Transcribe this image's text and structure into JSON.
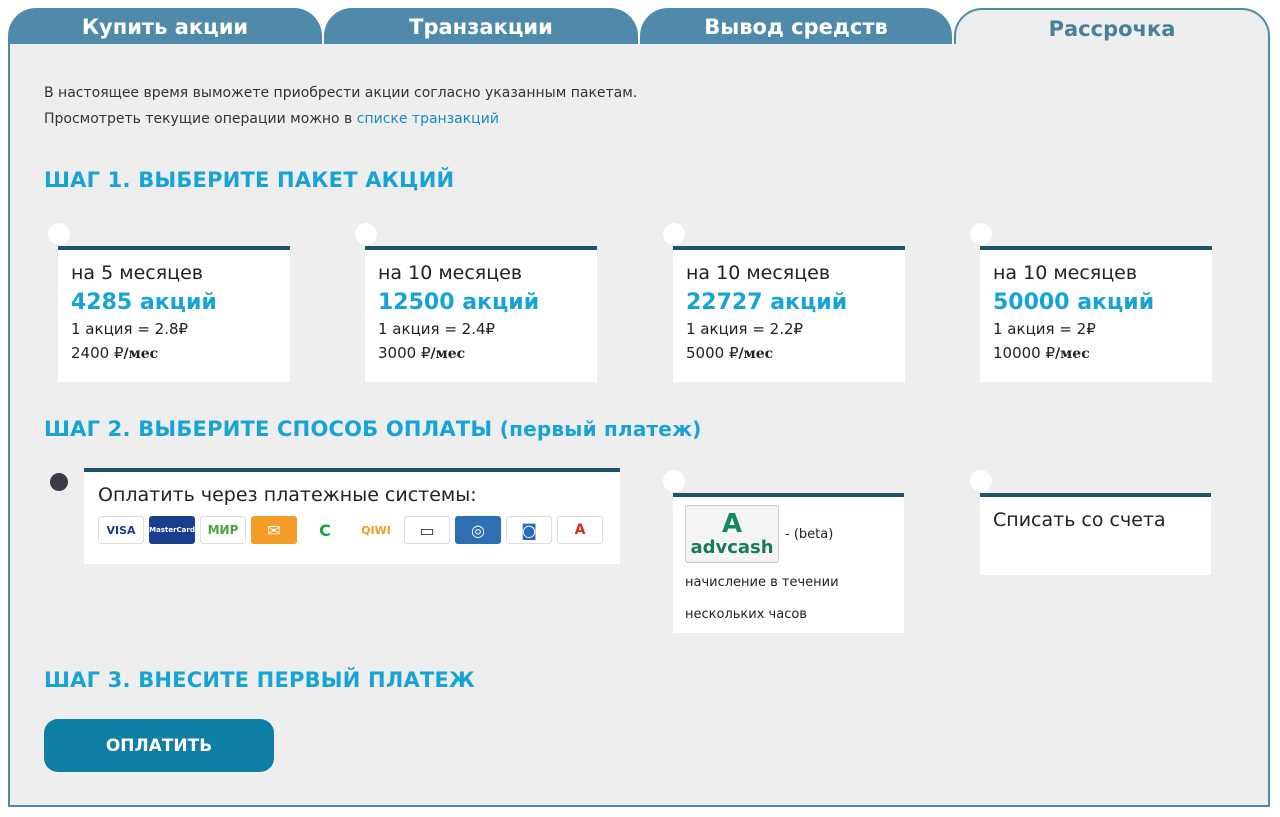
{
  "tabs": [
    {
      "label": "Купить акции",
      "active": false
    },
    {
      "label": "Транзакции",
      "active": false
    },
    {
      "label": "Вывод средств",
      "active": false
    },
    {
      "label": "Рассрочка",
      "active": true
    }
  ],
  "intro": {
    "line1": "В настоящее время выможете приобрести акции согласно указанным пакетам.",
    "line2_prefix": "Просмотреть текущие операции можно в ",
    "line2_link": "списке транзакций"
  },
  "step1": {
    "title": "ШАГ 1. ВЫБЕРИТЕ ПАКЕТ АКЦИЙ"
  },
  "packages": [
    {
      "months": "на 5 месяцев",
      "shares": "4285 акций",
      "price": "1 акция = 2.8₽",
      "monthly": "2400 ₽",
      "unit": "/мес"
    },
    {
      "months": "на 10 месяцев",
      "shares": "12500 акций",
      "price": "1 акция = 2.4₽",
      "monthly": "3000 ₽",
      "unit": "/мес"
    },
    {
      "months": "на 10 месяцев",
      "shares": "22727 акций",
      "price": "1 акция = 2.2₽",
      "monthly": "5000 ₽",
      "unit": "/мес"
    },
    {
      "months": "на 10 месяцев",
      "shares": "50000 акций",
      "price": "1 акция = 2₽",
      "monthly": "10000 ₽",
      "unit": "/мес"
    }
  ],
  "step2": {
    "title": "ШАГ 2. ВЫБЕРИТЕ СПОСОБ ОПЛАТЫ",
    "subtitle": "(первый платеж)"
  },
  "payment": {
    "systems_label": "Оплатить через платежные системы:",
    "logos": [
      {
        "text": "VISA",
        "color": "#ffffff",
        "fg": "#1a3b8f",
        "name": "visa-logo"
      },
      {
        "text": "MasterCard",
        "color": "#1b3e8c",
        "fg": "#ffffff",
        "name": "mastercard-logo"
      },
      {
        "text": "МИР",
        "color": "#ffffff",
        "fg": "#4aa43a",
        "name": "mir-logo"
      },
      {
        "text": "✉",
        "color": "#f39c27",
        "fg": "#ffffff",
        "name": "yandex-money-logo"
      },
      {
        "text": "С",
        "color": "#ffffff",
        "fg": "#1a9f3a",
        "name": "sberbank-logo"
      },
      {
        "text": "QIWI",
        "color": "#ffffff",
        "fg": "#f39c27",
        "name": "qiwi-logo"
      },
      {
        "text": "▭",
        "color": "#ffffff",
        "fg": "#333333",
        "name": "card-terminal-logo"
      },
      {
        "text": "◎",
        "color": "#2f6fb3",
        "fg": "#ffffff",
        "name": "webmoney-logo"
      },
      {
        "text": "◙",
        "color": "#ffffff",
        "fg": "#2a6db5",
        "name": "payment-system-logo"
      },
      {
        "text": "А",
        "color": "#ffffff",
        "fg": "#e3261e",
        "name": "alfa-bank-logo"
      }
    ],
    "advcash_mark": "A",
    "advcash_text": "advcash",
    "advcash_beta": "- (beta)",
    "advcash_note1": "начисление в течении",
    "advcash_note2": "нескольких часов",
    "account_label": "Списать со счета"
  },
  "step3": {
    "title": "ШАГ 3. ВНЕСИТЕ ПЕРВЫЙ ПЛАТЕЖ"
  },
  "pay_button": "ОПЛАТИТЬ"
}
